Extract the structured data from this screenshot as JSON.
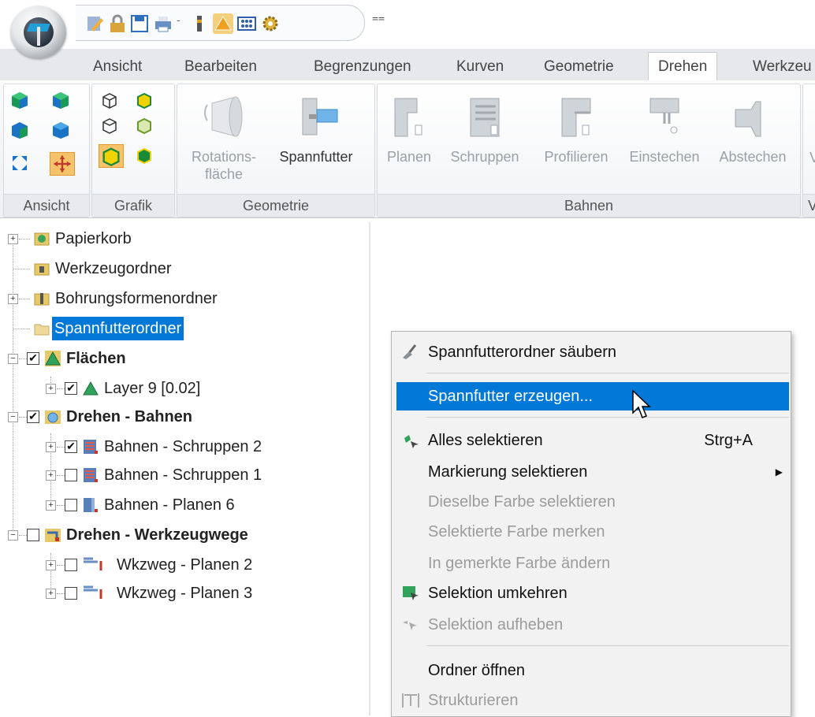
{
  "quick_access": {
    "dropdown_glyph": "⩵",
    "icons": [
      "pencil-icon",
      "lock-icon",
      "save-icon",
      "print-icon",
      "dropdown-arrow-icon",
      "bar-icon",
      "warning-icon",
      "grid-icon",
      "gear-icon"
    ]
  },
  "tabs": [
    {
      "label": "Ansicht",
      "active": false
    },
    {
      "label": "Bearbeiten",
      "active": false
    },
    {
      "label": "Begrenzungen",
      "active": false
    },
    {
      "label": "Kurven",
      "active": false
    },
    {
      "label": "Geometrie",
      "active": false
    },
    {
      "label": "Drehen",
      "active": true
    },
    {
      "label": "Werkzeu",
      "active": false
    }
  ],
  "ribbon": {
    "groups": {
      "ansicht": "Ansicht",
      "grafik": "Grafik",
      "geometrie": "Geometrie",
      "bahnen": "Bahnen",
      "cut": "V"
    },
    "geometrie_buttons": {
      "rotation_line1": "Rotations-",
      "rotation_line2": "fläche",
      "chuck": "Spannfutter"
    },
    "bahnen_buttons": [
      "Planen",
      "Schruppen",
      "Profilieren",
      "Einstechen",
      "Abstechen"
    ],
    "cut_button": "V"
  },
  "tree": {
    "items": [
      {
        "label": "Papierkorb",
        "bold": false,
        "expander": true,
        "checkbox": null,
        "icon": "recycle-bin-icon",
        "selected": false
      },
      {
        "label": "Werkzeugordner",
        "bold": false,
        "expander": false,
        "checkbox": null,
        "icon": "tool-folder-icon",
        "selected": false
      },
      {
        "label": "Bohrungsformenordner",
        "bold": false,
        "expander": true,
        "checkbox": null,
        "icon": "drill-folder-icon",
        "selected": false
      },
      {
        "label": "Spannfutterordner",
        "bold": false,
        "expander": false,
        "checkbox": null,
        "icon": "folder-icon",
        "selected": true
      },
      {
        "label": "Flächen",
        "bold": true,
        "expander": true,
        "checkbox": true,
        "icon": "surfaces-icon",
        "selected": false
      },
      {
        "label": "Layer 9 [0.02]",
        "bold": false,
        "expander": true,
        "checkbox": true,
        "icon": "layer-icon",
        "selected": false
      },
      {
        "label": "Drehen - Bahnen",
        "bold": true,
        "expander": true,
        "checkbox": true,
        "icon": "turning-paths-icon",
        "selected": false
      },
      {
        "label": "Bahnen - Schruppen 2",
        "bold": false,
        "expander": true,
        "checkbox": true,
        "icon": "roughing-path-icon",
        "selected": false
      },
      {
        "label": "Bahnen - Schruppen 1",
        "bold": false,
        "expander": true,
        "checkbox": false,
        "icon": "roughing-path-icon",
        "selected": false
      },
      {
        "label": "Bahnen - Planen 6",
        "bold": false,
        "expander": true,
        "checkbox": false,
        "icon": "facing-path-icon",
        "selected": false
      },
      {
        "label": "Drehen - Werkzeugwege",
        "bold": true,
        "expander": true,
        "checkbox": false,
        "icon": "toolpaths-icon",
        "selected": false
      },
      {
        "label": "Wkzweg - Planen 2",
        "bold": false,
        "expander": true,
        "checkbox": false,
        "icon": "toolpath-icon",
        "selected": false
      },
      {
        "label": "Wkzweg - Planen 3",
        "bold": false,
        "expander": true,
        "checkbox": false,
        "icon": "toolpath-icon",
        "selected": false
      }
    ]
  },
  "context_menu": {
    "items": [
      {
        "label": "Spannfutterordner säubern",
        "shortcut": "",
        "disabled": false,
        "hover": false,
        "submenu": false,
        "icon": "broom-icon"
      },
      {
        "label": "Spannfutter erzeugen...",
        "shortcut": "",
        "disabled": false,
        "hover": true,
        "submenu": false,
        "icon": ""
      },
      {
        "label": "Alles selektieren",
        "shortcut": "Strg+A",
        "disabled": false,
        "hover": false,
        "submenu": false,
        "icon": "select-all-icon"
      },
      {
        "label": "Markierung selektieren",
        "shortcut": "",
        "disabled": false,
        "hover": false,
        "submenu": true,
        "icon": ""
      },
      {
        "label": "Dieselbe Farbe selektieren",
        "shortcut": "",
        "disabled": true,
        "hover": false,
        "submenu": false,
        "icon": ""
      },
      {
        "label": "Selektierte Farbe merken",
        "shortcut": "",
        "disabled": true,
        "hover": false,
        "submenu": false,
        "icon": ""
      },
      {
        "label": "In gemerkte Farbe ändern",
        "shortcut": "",
        "disabled": true,
        "hover": false,
        "submenu": false,
        "icon": ""
      },
      {
        "label": "Selektion umkehren",
        "shortcut": "",
        "disabled": false,
        "hover": false,
        "submenu": false,
        "icon": "invert-selection-icon"
      },
      {
        "label": "Selektion aufheben",
        "shortcut": "",
        "disabled": true,
        "hover": false,
        "submenu": false,
        "icon": "deselect-icon"
      },
      {
        "label": "Ordner öffnen",
        "shortcut": "",
        "disabled": false,
        "hover": false,
        "submenu": false,
        "icon": ""
      },
      {
        "label": "Strukturieren",
        "shortcut": "",
        "disabled": true,
        "hover": false,
        "submenu": false,
        "icon": "structure-icon"
      }
    ]
  }
}
